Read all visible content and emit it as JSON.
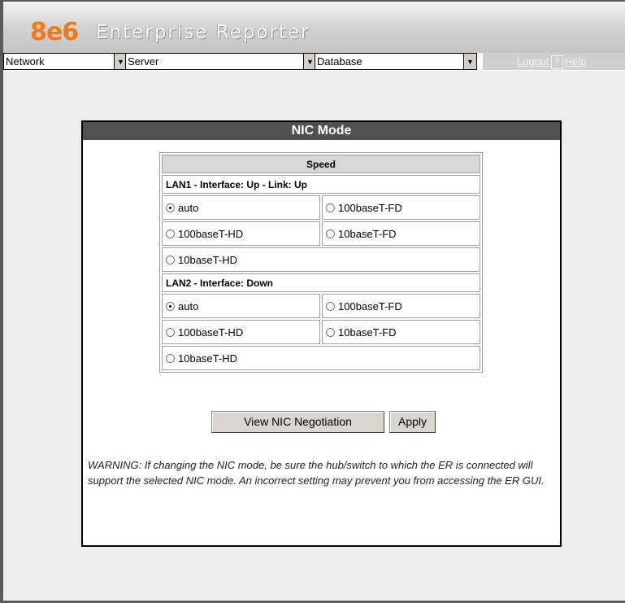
{
  "brand": {
    "logo": "8e6",
    "product": "Enterprise Reporter"
  },
  "menu": {
    "dropdowns": [
      {
        "label": "Network"
      },
      {
        "label": "Server"
      },
      {
        "label": "Database"
      }
    ],
    "logout": "Logout",
    "help_icon": "?",
    "help": "Help"
  },
  "panel": {
    "title": "NIC Mode",
    "table_header": "Speed",
    "lan1": {
      "title": "LAN1 - Interface: Up - Link: Up",
      "options": [
        "auto",
        "100baseT-FD",
        "100baseT-HD",
        "10baseT-FD",
        "10baseT-HD"
      ],
      "selected": "auto"
    },
    "lan2": {
      "title": "LAN2 - Interface: Down",
      "options": [
        "auto",
        "100baseT-FD",
        "100baseT-HD",
        "10baseT-FD",
        "10baseT-HD"
      ],
      "selected": "auto"
    },
    "buttons": {
      "view": "View NIC Negotiation",
      "apply": "Apply"
    },
    "warning": "WARNING: If changing the NIC mode, be sure the hub/switch to which the ER is connected will support the selected NIC mode. An incorrect setting may prevent you from accessing the ER GUI."
  }
}
